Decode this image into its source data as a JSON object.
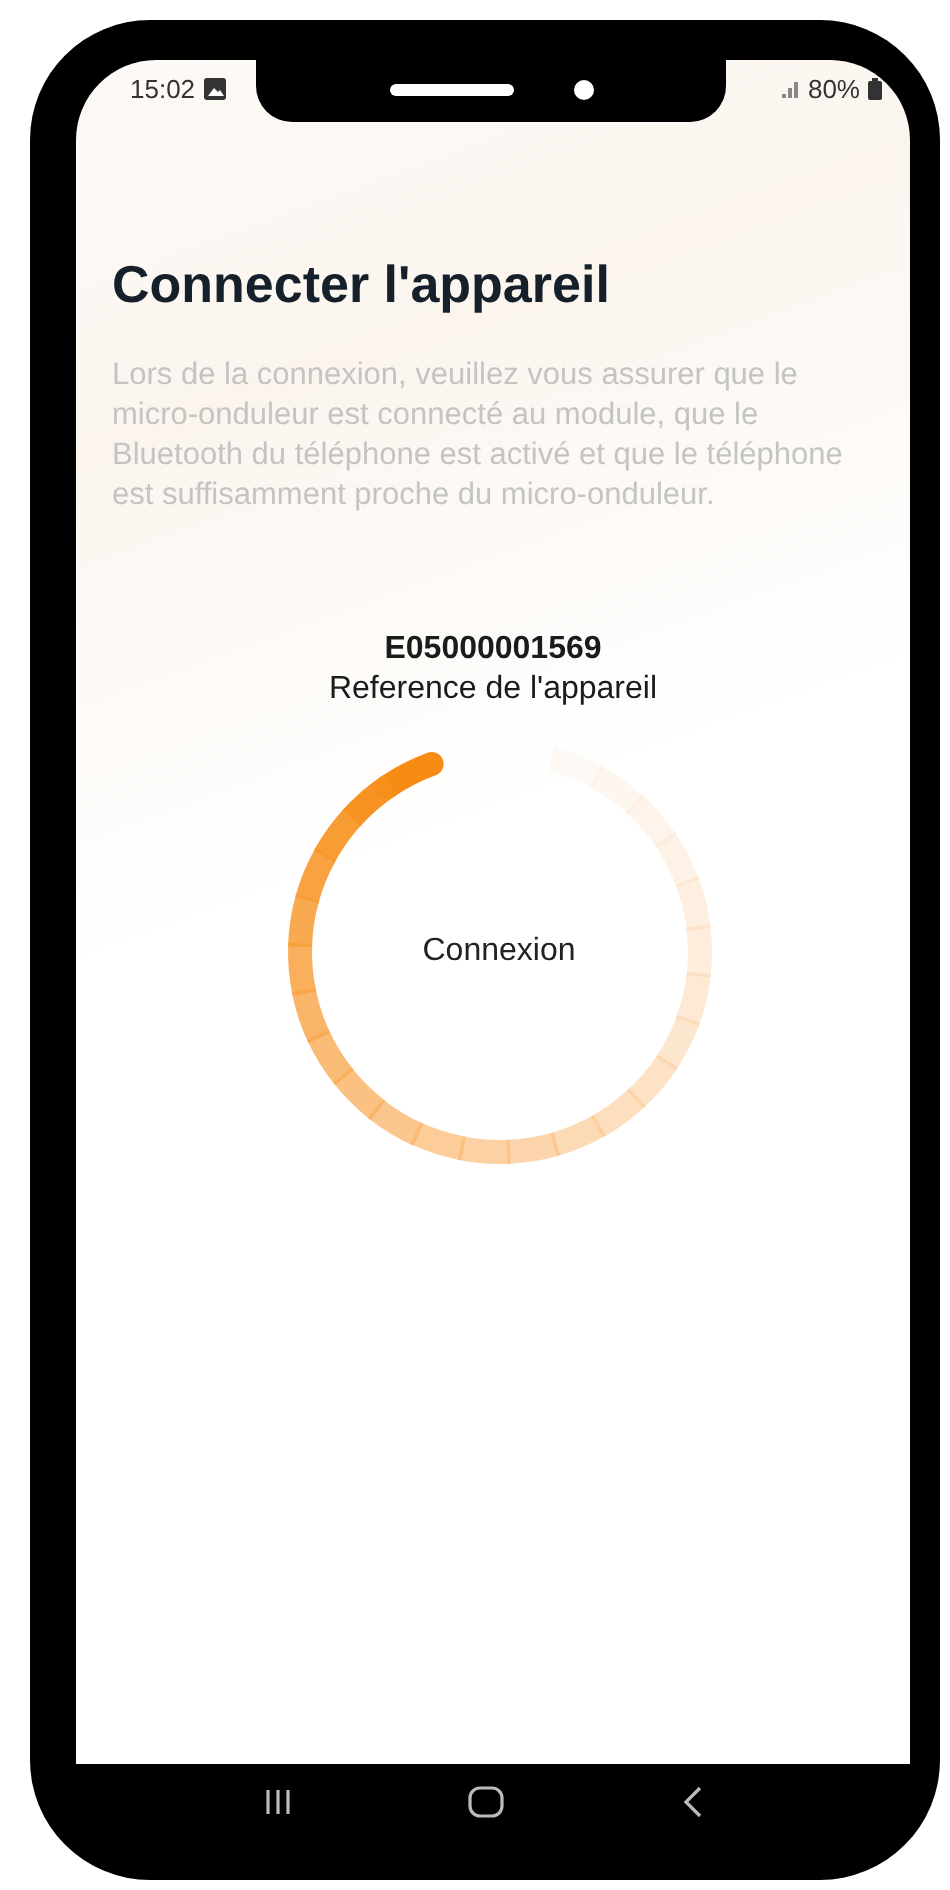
{
  "status_bar": {
    "time": "15:02",
    "battery": "80%"
  },
  "title": "Connecter l'appareil",
  "description": "Lors de la connexion, veuillez vous assurer que le micro-onduleur est connecté au module, que le Bluetooth du téléphone est activé et que le téléphone est suffisamment proche du micro-onduleur.",
  "device": {
    "serial": "E05000001569",
    "label": "Reference de l'appareil"
  },
  "progress": {
    "label": "Connexion"
  }
}
